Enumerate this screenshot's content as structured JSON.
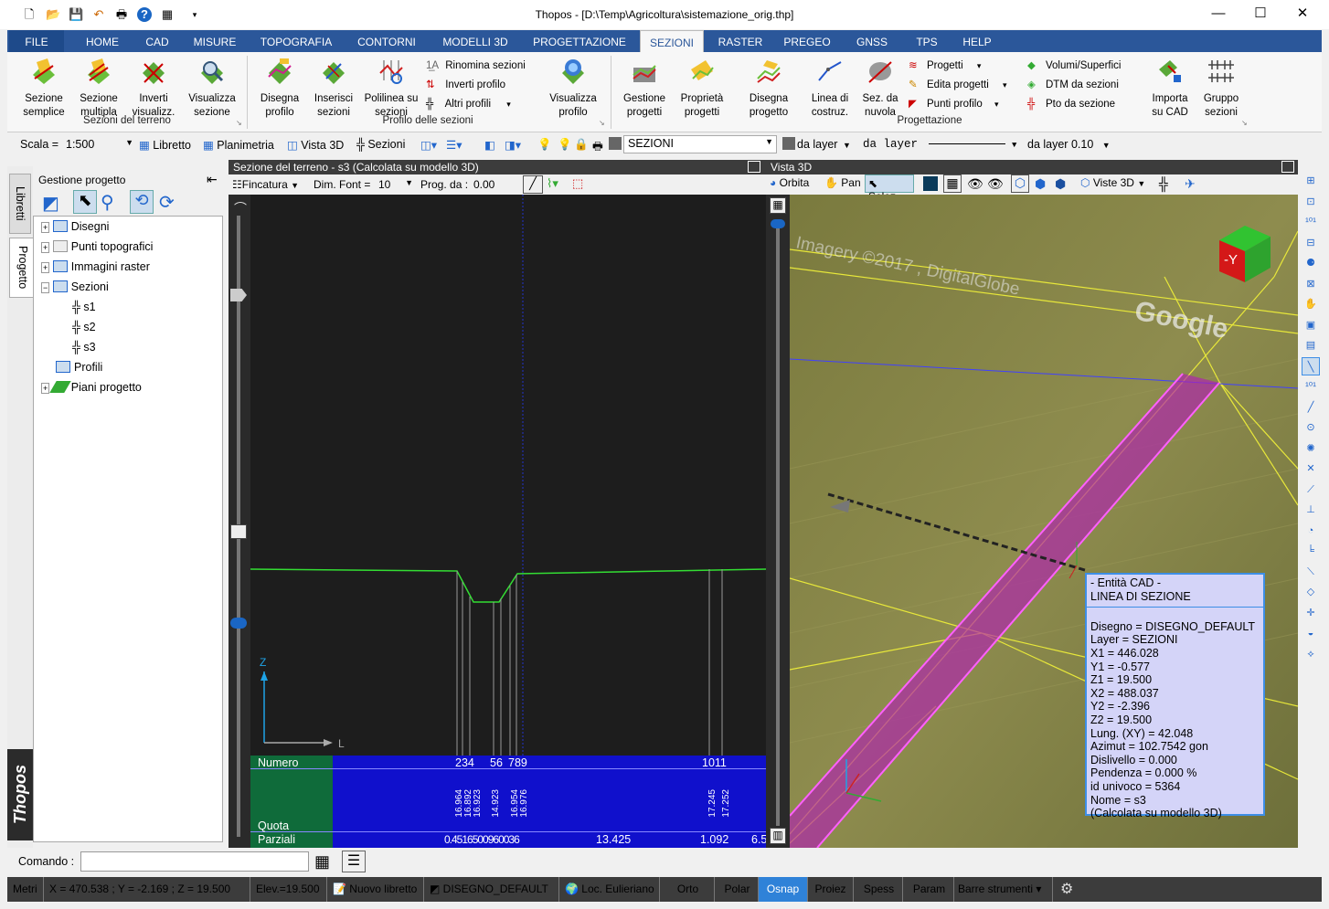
{
  "window": {
    "title": "Thopos - [D:\\Temp\\Agricoltura\\sistemazione_orig.thp]"
  },
  "menu": {
    "tabs": [
      "FILE",
      "HOME",
      "CAD",
      "MISURE",
      "TOPOGRAFIA",
      "CONTORNI",
      "MODELLI 3D",
      "PROGETTAZIONE",
      "SEZIONI",
      "RASTER",
      "PREGEO",
      "GNSS",
      "TPS",
      "HELP"
    ],
    "active": "SEZIONI"
  },
  "ribbon": {
    "g1": {
      "label": "Sezioni del terreno",
      "b1": "Sezione semplice",
      "b2": "Sezione multipla",
      "b3": "Inverti visualizz.",
      "b4": "Visualizza sezione"
    },
    "g2": {
      "label": "Profilo delle sezioni",
      "b1": "Disegna profilo",
      "b2": "Inserisci sezioni",
      "b3": "Polilinea su sezioni",
      "s1": "Rinomina sezioni",
      "s2": "Inverti profilo",
      "s3": "Altri profili",
      "b4": "Visualizza profilo"
    },
    "g3": {
      "label": "Progettazione",
      "b1": "Gestione progetti",
      "b2": "Proprietà progetti",
      "b3": "Disegna progetto",
      "b4": "Linea di costruz.",
      "b5": "Sez. da nuvola",
      "s1": "Progetti",
      "s2": "Edita progetti",
      "s3": "Punti profilo",
      "s4": "Volumi/Superfici",
      "s5": "DTM da sezioni",
      "s6": "Pto da sezione",
      "b6": "Importa su CAD",
      "b7": "Gruppo sezioni"
    }
  },
  "toolbar": {
    "scale_label": "Scala =",
    "scale_value": "1:500",
    "libretto": "Libretto",
    "planimetria": "Planimetria",
    "vista3d": "Vista 3D",
    "sezioni": "Sezioni",
    "layer": "SEZIONI",
    "color": "da layer",
    "linetype": "da layer",
    "lineweight": "da layer 0.10"
  },
  "left_panel": {
    "title": "Gestione progetto",
    "vtab1": "Libretti",
    "vtab2": "Progetto",
    "brand": "Thopos",
    "tree": [
      "Disegni",
      "Punti topografici",
      "Immagini raster",
      "Sezioni",
      "s1",
      "s2",
      "s3",
      "Profili",
      "Piani progetto"
    ]
  },
  "section_view": {
    "title": "Sezione del terreno - s3 (Calcolata su modello 3D)",
    "fincatura": "Fincatura",
    "dimfont_label": "Dim. Font =",
    "dimfont_value": "10",
    "prog_label": "Prog. da :",
    "prog_value": "0.00",
    "axis_z": "Z",
    "axis_l": "L",
    "table": {
      "row1": "Numero",
      "row2": "Quota",
      "row3": "Parziali",
      "numbers": [
        "234",
        "56",
        "789",
        "1011"
      ],
      "quote": [
        "16.964",
        "16.892",
        "16.923",
        "14.923",
        "16.954",
        "16.976",
        "17.245",
        "17.252"
      ],
      "parziali": [
        "0.4516500960036",
        "13.425",
        "1.092",
        "6.5"
      ]
    }
  },
  "view3d": {
    "title": "Vista 3D",
    "orbita": "Orbita",
    "pan": "Pan",
    "selez": "Selez.",
    "viste": "Viste 3D",
    "watermark": "Imagery ©2017 , DigitalGlobe",
    "google": "Google",
    "cube": "-Y",
    "info": [
      "- Entità CAD -",
      "LINEA DI SEZIONE",
      "",
      "Disegno = DISEGNO_DEFAULT",
      "Layer = SEZIONI",
      "X1 = 446.028",
      "Y1 = -0.577",
      "Z1 = 19.500",
      "X2 = 488.037",
      "Y2 = -2.396",
      "Z2 = 19.500",
      "Lung. (XY) = 42.048",
      "Azimut = 102.7542 gon",
      "Dislivello = 0.000",
      "Pendenza = 0.000 %",
      "id univoco = 5364",
      "Nome = s3",
      "(Calcolata su modello 3D)"
    ]
  },
  "command": {
    "label": "Comando :",
    "value": ""
  },
  "status": {
    "units": "Metri",
    "coords": "X = 470.538 ; Y = -2.169 ; Z = 19.500",
    "elev": "Elev.=19.500",
    "libretto": "Nuovo libretto",
    "disegno": "DISEGNO_DEFAULT",
    "loc": "Loc. Eulieriano",
    "orto": "Orto",
    "polar": "Polar",
    "osnap": "Osnap",
    "proiez": "Proiez",
    "spess": "Spess",
    "param": "Param",
    "barre": "Barre strumenti"
  }
}
